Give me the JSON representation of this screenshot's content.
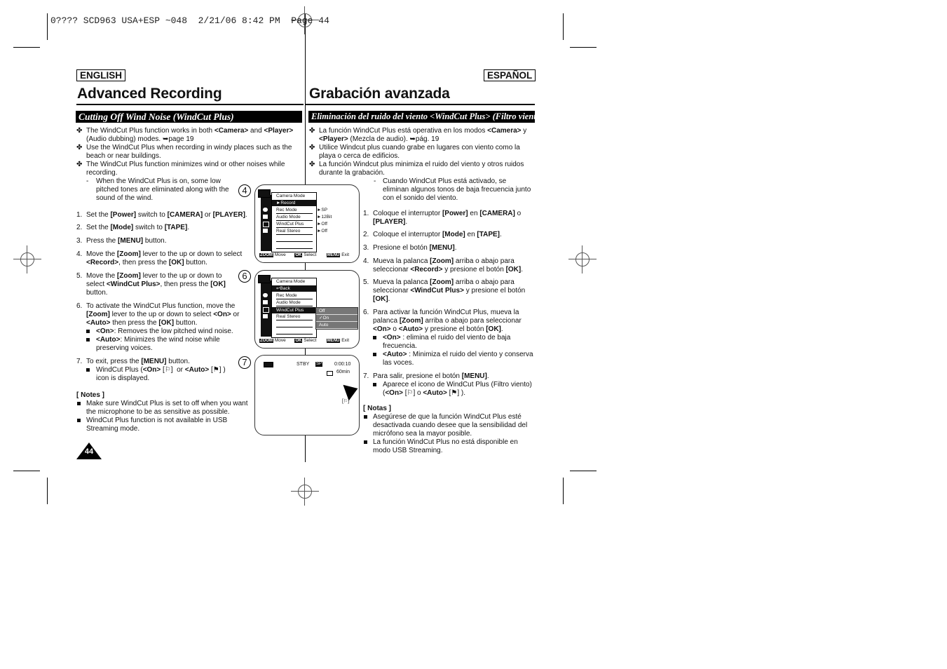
{
  "slug": "0???? SCD963 USA+ESP ~048  2/21/06 8:42 PM  Page 44",
  "english": {
    "lang_label": "ENGLISH",
    "title": "Advanced Recording",
    "section": "Cutting Off Wind Noise (WindCut Plus)",
    "intro": [
      {
        "html": "The WindCut Plus function works in both <b>&lt;Camera&gt;</b> and <b>&lt;Player&gt;</b> (Audio dubbing) modes. ➥page 19"
      },
      {
        "html": "Use the WindCut Plus when recording in windy places such as the beach or near buildings."
      },
      {
        "html": "The WindCut Plus function minimizes wind or other noises while recording."
      }
    ],
    "intro_sub": "When the WindCut Plus is on, some low pitched tones are eliminated along with the sound of the wind.",
    "steps": [
      {
        "num": "1.",
        "html": "Set the <b>[Power]</b> switch to <b>[CAMERA]</b> or <b>[PLAYER]</b>."
      },
      {
        "num": "2.",
        "html": "Set the <b>[Mode]</b> switch to <b>[TAPE]</b>."
      },
      {
        "num": "3.",
        "html": "Press the <b>[MENU]</b> button."
      },
      {
        "num": "4.",
        "html": "Move the <b>[Zoom]</b> lever to the up or down to select <b>&lt;Record&gt;</b>, then press the <b>[OK]</b> button."
      },
      {
        "num": "5.",
        "html": "Move the <b>[Zoom]</b> lever to the up or down to select <b>&lt;WindCut Plus&gt;</b>, then press the <b>[OK]</b> button."
      },
      {
        "num": "6.",
        "html": "To activate the WindCut Plus function, move the <b>[Zoom]</b> lever to the up or down to select <b>&lt;On&gt;</b> or <b>&lt;Auto&gt;</b> then press the <b>[OK]</b> button."
      },
      {
        "num": "7.",
        "html": "To exit, press the <b>[MENU]</b> button."
      }
    ],
    "step6_bullets": [
      {
        "html": "<b>&lt;On&gt;</b>: Removes the low pitched wind noise."
      },
      {
        "html": "<b>&lt;Auto&gt;</b>: Minimizes the wind noise while preserving voices."
      }
    ],
    "step7_bullets": [
      {
        "html": "WindCut Plus (<b>&lt;On&gt;</b> [⚐]&nbsp; or <b>&lt;Auto&gt;</b> [⚑] ) icon is displayed."
      }
    ],
    "notes_title": "[ Notes ]",
    "notes": [
      "Make sure WindCut Plus is set to off when you want the microphone to be as sensitive as possible.",
      "WindCut Plus function is not available in USB Streaming mode."
    ],
    "page_number": "44"
  },
  "spanish": {
    "lang_label": "ESPAÑOL",
    "title": "Grabación avanzada",
    "section": "Eliminación del ruido del viento <WindCut Plus> (Filtro viento)",
    "intro": [
      {
        "html": "La función WindCut Plus está operativa en los modos <b>&lt;Camera&gt;</b> y <b>&lt;Player&gt;</b> (Mezcla de audio). ➥pág. 19"
      },
      {
        "html": "Utilice Windcut plus cuando grabe en lugares con viento como la playa o cerca de edificios."
      },
      {
        "html": "La función Windcut plus minimiza el ruido del viento y otros ruidos durante la grabación."
      }
    ],
    "intro_sub": "Cuando WindCut Plus está activado, se eliminan algunos tonos de baja frecuencia junto con el sonido del viento.",
    "steps": [
      {
        "num": "1.",
        "html": "Coloque el interruptor <b>[Power]</b> en <b>[CAMERA]</b> o <b>[PLAYER]</b>."
      },
      {
        "num": "2.",
        "html": "Coloque el interruptor <b>[Mode]</b> en <b>[TAPE]</b>."
      },
      {
        "num": "3.",
        "html": "Presione el botón <b>[MENU]</b>."
      },
      {
        "num": "4.",
        "html": "Mueva la palanca <b>[Zoom]</b> arriba o abajo para seleccionar <b>&lt;Record&gt;</b> y presione el botón <b>[OK]</b>."
      },
      {
        "num": "5.",
        "html": "Mueva la palanca <b>[Zoom]</b> arriba o abajo para seleccionar <b>&lt;WindCut Plus&gt;</b> y presione el botón <b>[OK]</b>."
      },
      {
        "num": "6.",
        "html": "Para activar la función WindCut Plus, mueva la palanca <b>[Zoom]</b> arriba o abajo para seleccionar <b>&lt;On&gt;</b> o <b>&lt;Auto&gt;</b> y presione el botón <b>[OK]</b>."
      },
      {
        "num": "7.",
        "html": "Para salir, presione el botón <b>[MENU]</b>."
      }
    ],
    "step6_bullets": [
      {
        "html": "<b>&lt;On&gt;</b> : elimina el ruido del viento de baja frecuencia."
      },
      {
        "html": "<b>&lt;Auto&gt;</b> : Minimiza el ruido del viento y conserva las voces."
      }
    ],
    "step7_bullets": [
      {
        "html": "Aparece el icono de WindCut Plus (Filtro viento) (<b>&lt;On&gt;</b> [⚐] o <b>&lt;Auto&gt;</b> [⚑] )."
      }
    ],
    "notes_title": "[ Notas ]",
    "notes": [
      "Asegúrese de que la función WindCut Plus esté desactivada cuando desee que la sensibilidad del micrófono sea la mayor posible.",
      "La función WindCut Plus no está disponible en modo USB Streaming."
    ]
  },
  "figures": {
    "fig4": {
      "number": "4",
      "header": "Camera Mode",
      "selected": "►Record",
      "rows": [
        "Rec Mode",
        "Audio Mode",
        "WindCut Plus",
        "Real Stereo"
      ],
      "values": [
        "►SP",
        "►12Bit",
        "►Off",
        "►Off"
      ],
      "footer": {
        "zoom": "ZOOM",
        "move": "Move",
        "ok": "OK",
        "select": "Select",
        "menu": "MENU",
        "exit": "Exit"
      }
    },
    "fig6": {
      "number": "6",
      "header": "Camera Mode",
      "selected": "↩Back",
      "rows": [
        "Rec Mode",
        "Audio Mode",
        "WindCut Plus",
        "Real Stereo"
      ],
      "options": [
        "Off",
        "✓On",
        "Auto"
      ],
      "footer": {
        "zoom": "ZOOM",
        "move": "Move",
        "ok": "OK",
        "select": "Select",
        "menu": "MENU",
        "exit": "Exit"
      }
    },
    "fig7": {
      "number": "7",
      "status": "STBY",
      "speed": "SP",
      "time": "0:00:10",
      "remaining": "60min",
      "windcut_icon": "[⚐]"
    }
  }
}
